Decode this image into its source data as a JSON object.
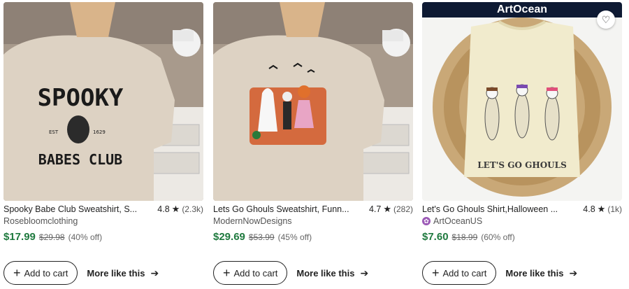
{
  "products": [
    {
      "title": "Spooky Babe Club Sweatshirt, S...",
      "rating": "4.8",
      "review_count": "(2.3k)",
      "shop": "Rosebloomclothing",
      "price": "$17.99",
      "original_price": "$29.98",
      "discount": "(40% off)",
      "print_line1": "SPOOKY",
      "print_small1": "EST",
      "print_small2": "1629",
      "print_line2": "BABES CLUB"
    },
    {
      "title": "Lets Go Ghouls Sweatshirt, Funn...",
      "rating": "4.7",
      "review_count": "(282)",
      "shop": "ModernNowDesigns",
      "price": "$29.69",
      "original_price": "$53.99",
      "discount": "(45% off)"
    },
    {
      "title": "Let's Go Ghouls Shirt,Halloween ...",
      "rating": "4.8",
      "review_count": "(1k)",
      "shop": "ArtOceanUS",
      "price": "$7.60",
      "original_price": "$18.99",
      "discount": "(60% off)",
      "brand": "ArtOcean",
      "print_text": "LET'S GO GHOULS"
    }
  ],
  "actions": {
    "add_to_cart": "Add to cart",
    "more_like_this": "More like this"
  },
  "icons": {
    "star": "star-icon",
    "plus": "plus-icon",
    "arrow": "arrow-right-icon",
    "heart": "heart-icon",
    "star_seller": "star-seller-badge-icon"
  },
  "colors": {
    "price": "#1f7a3f",
    "star_seller_badge": "#9b59b6"
  }
}
